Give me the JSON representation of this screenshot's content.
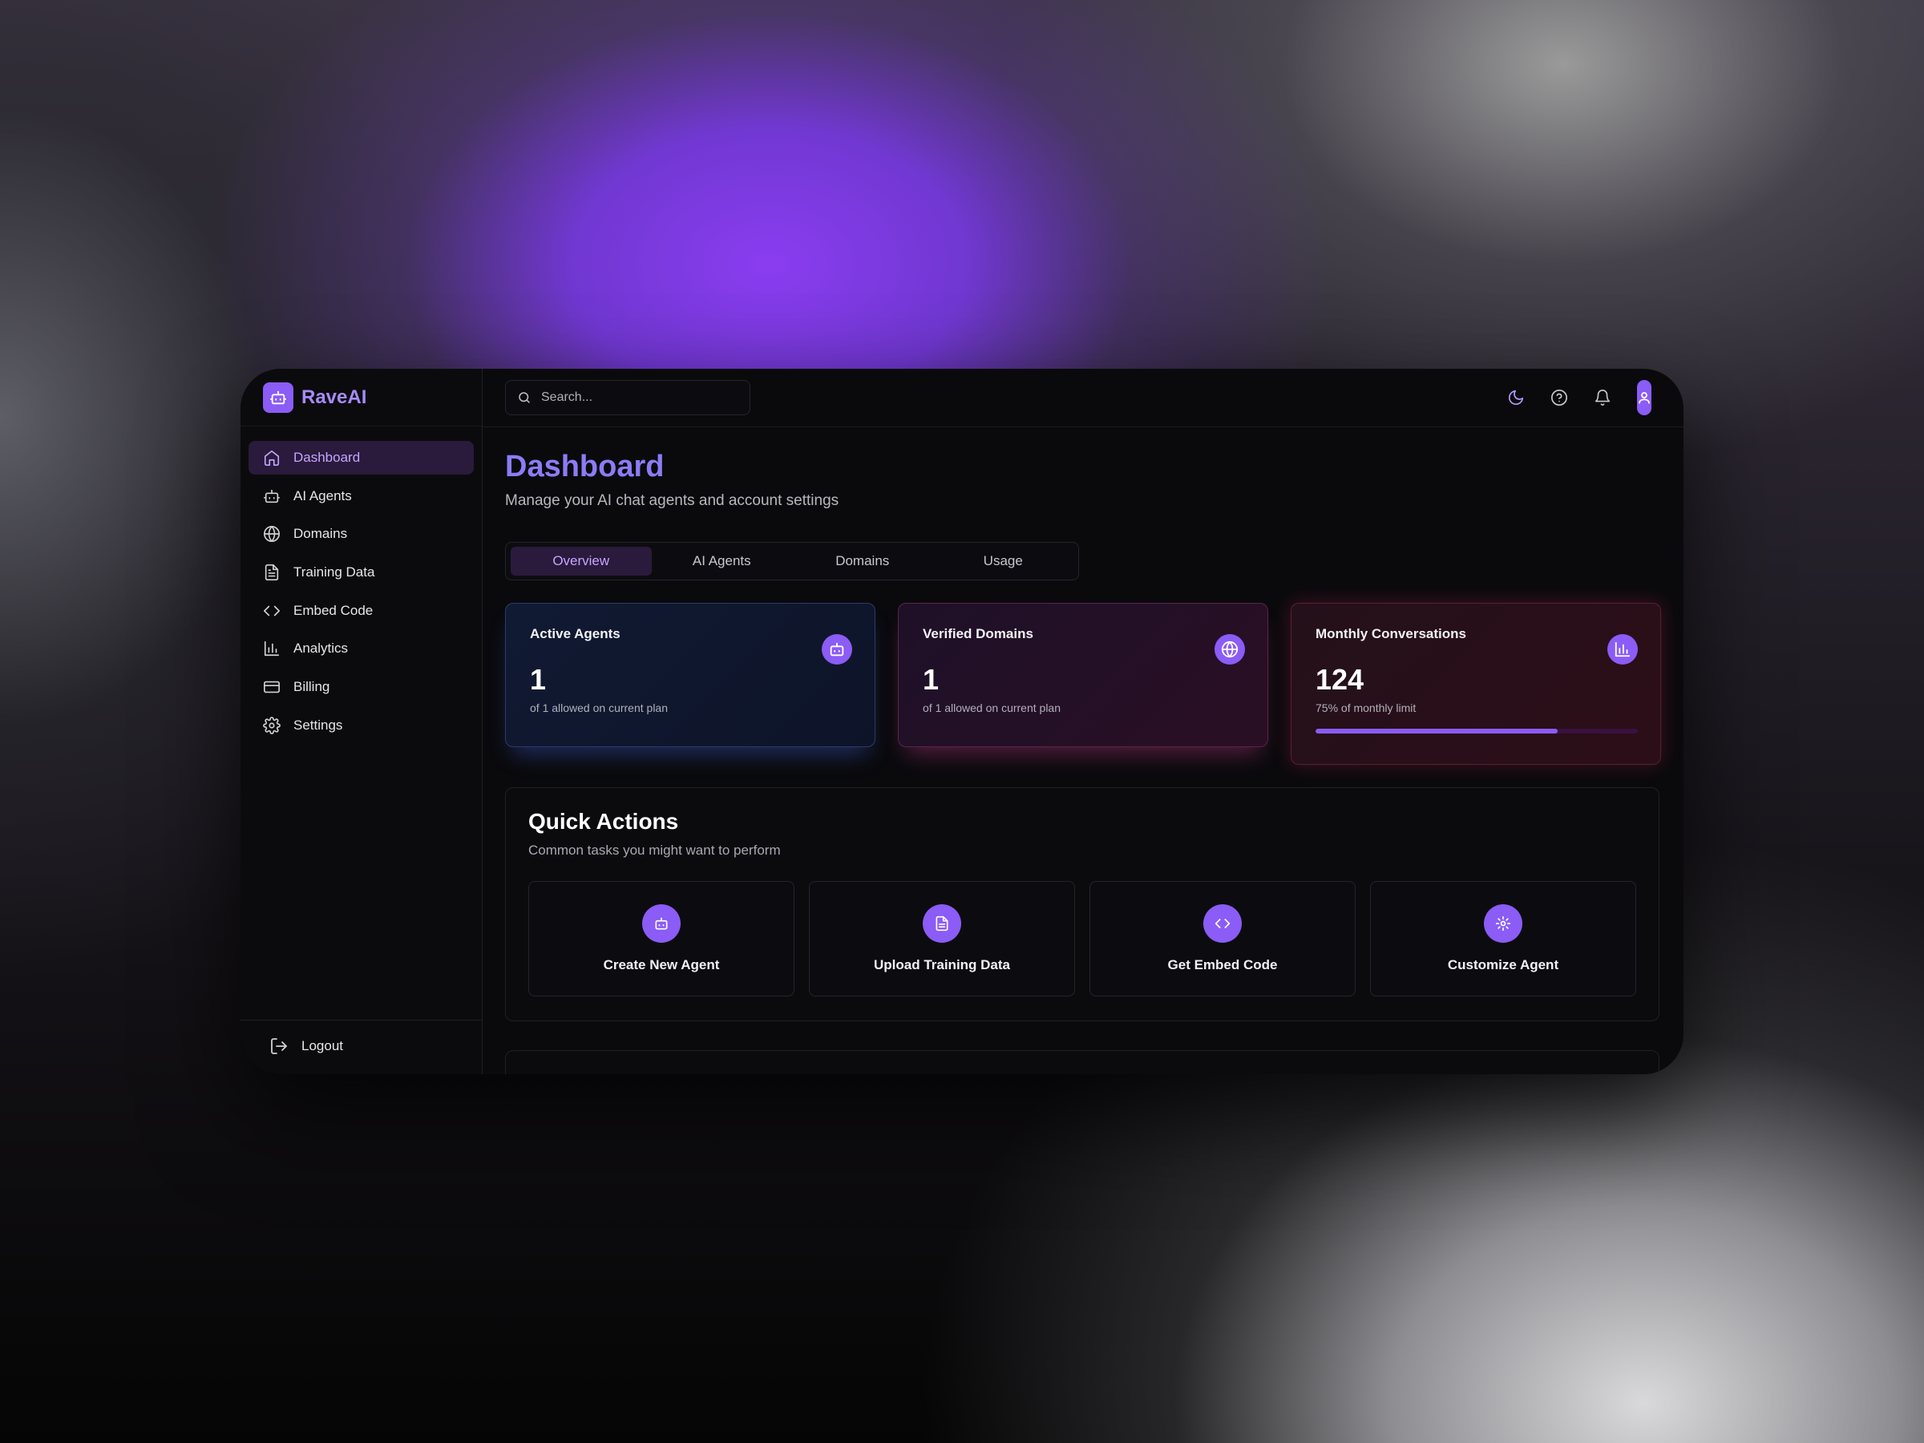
{
  "brand": {
    "name": "RaveAI"
  },
  "sidebar": {
    "items": [
      {
        "label": "Dashboard",
        "icon": "home-icon",
        "active": true
      },
      {
        "label": "AI Agents",
        "icon": "bot-icon"
      },
      {
        "label": "Domains",
        "icon": "globe-icon"
      },
      {
        "label": "Training Data",
        "icon": "file-text-icon"
      },
      {
        "label": "Embed Code",
        "icon": "code-icon"
      },
      {
        "label": "Analytics",
        "icon": "bar-chart-icon"
      },
      {
        "label": "Billing",
        "icon": "credit-card-icon"
      },
      {
        "label": "Settings",
        "icon": "gear-icon"
      }
    ],
    "logout_label": "Logout"
  },
  "topbar": {
    "search_placeholder": "Search..."
  },
  "page": {
    "title": "Dashboard",
    "subtitle": "Manage your AI chat agents and account settings"
  },
  "tabs": [
    {
      "label": "Overview",
      "active": true
    },
    {
      "label": "AI Agents"
    },
    {
      "label": "Domains"
    },
    {
      "label": "Usage"
    }
  ],
  "stats": [
    {
      "title": "Active Agents",
      "value": "1",
      "note": "of 1 allowed on current plan",
      "icon": "bot-icon"
    },
    {
      "title": "Verified Domains",
      "value": "1",
      "note": "of 1 allowed on current plan",
      "icon": "globe-icon"
    },
    {
      "title": "Monthly Conversations",
      "value": "124",
      "note": "75% of monthly limit",
      "icon": "bar-chart-icon",
      "progress_percent": 75
    }
  ],
  "quick_actions": {
    "title": "Quick Actions",
    "subtitle": "Common tasks you might want to perform",
    "items": [
      {
        "label": "Create New Agent",
        "icon": "bot-icon"
      },
      {
        "label": "Upload Training Data",
        "icon": "file-text-icon"
      },
      {
        "label": "Get Embed Code",
        "icon": "code-icon"
      },
      {
        "label": "Customize Agent",
        "icon": "gear-icon"
      }
    ]
  },
  "colors": {
    "accent": "#8b5cf6",
    "accent_text": "#c4a6ff",
    "title": "#8b7cf6",
    "window_bg": "#0a0a0d"
  }
}
